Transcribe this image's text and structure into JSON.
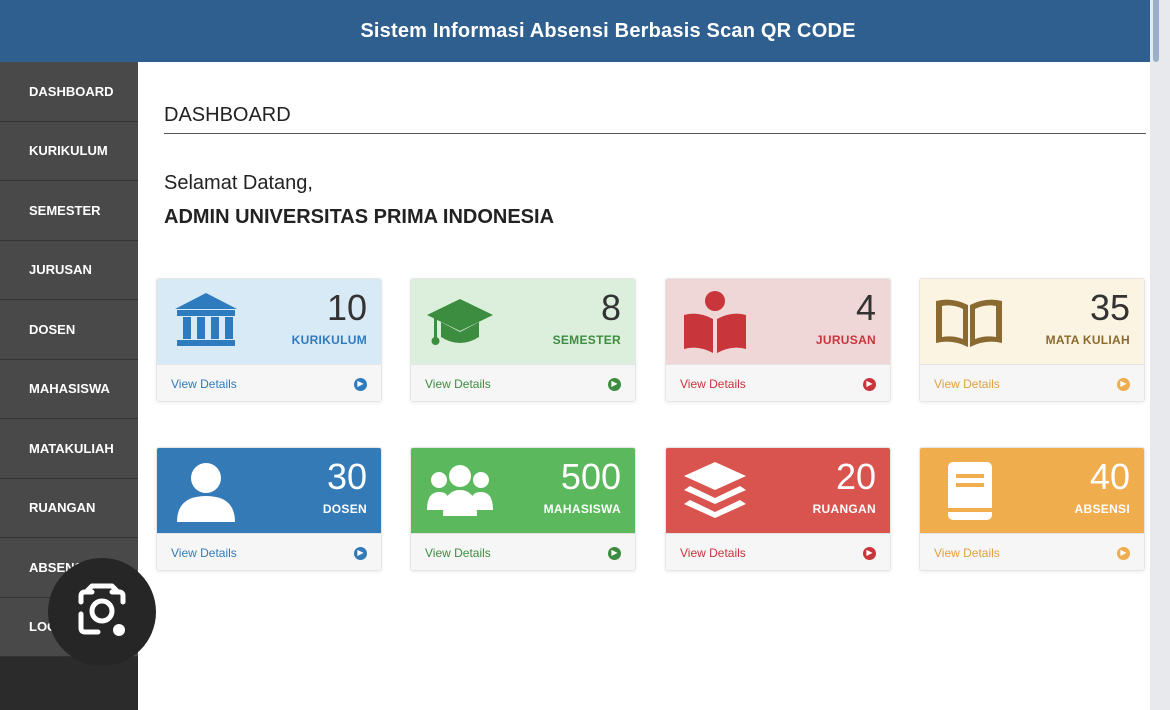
{
  "header": {
    "title": "Sistem Informasi Absensi Berbasis Scan QR CODE"
  },
  "sidebar": {
    "items": [
      {
        "label": "DASHBOARD"
      },
      {
        "label": "KURIKULUM"
      },
      {
        "label": "SEMESTER"
      },
      {
        "label": "JURUSAN"
      },
      {
        "label": "DOSEN"
      },
      {
        "label": "MAHASISWA"
      },
      {
        "label": "MATAKULIAH"
      },
      {
        "label": "RUANGAN"
      },
      {
        "label": "ABSENSI"
      },
      {
        "label": "LOGOUT"
      }
    ]
  },
  "main": {
    "page_title": "DASHBOARD",
    "welcome": "Selamat Datang,",
    "user_name": "ADMIN UNIVERSITAS PRIMA INDONESIA"
  },
  "cards": [
    {
      "count": "10",
      "label": "KURIKULUM",
      "link": "View Details",
      "icon": "building-icon",
      "color": "#2f7bbf",
      "bg": "#d9eaf7"
    },
    {
      "count": "8",
      "label": "SEMESTER",
      "link": "View Details",
      "icon": "graduation-cap-icon",
      "color": "#3c8d3f",
      "bg": "#dcefdc"
    },
    {
      "count": "4",
      "label": "JURUSAN",
      "link": "View Details",
      "icon": "reader-icon",
      "color": "#c8353a",
      "bg": "#f0d7d7"
    },
    {
      "count": "35",
      "label": "MATA KULIAH",
      "link": "View Details",
      "icon": "book-open-icon",
      "color": "#8a6a30",
      "bg": "#fcf4e2"
    },
    {
      "count": "30",
      "label": "DOSEN",
      "link": "View Details",
      "icon": "user-icon",
      "color": "#337ab7",
      "bg": "#337ab7"
    },
    {
      "count": "500",
      "label": "MAHASISWA",
      "link": "View Details",
      "icon": "users-icon",
      "color": "#5cb85c",
      "bg": "#5cb85c"
    },
    {
      "count": "20",
      "label": "RUANGAN",
      "link": "View Details",
      "icon": "layers-icon",
      "color": "#d9534f",
      "bg": "#d9534f"
    },
    {
      "count": "40",
      "label": "ABSENSI",
      "link": "View Details",
      "icon": "book-icon",
      "color": "#f0ad4e",
      "bg": "#f0ad4e"
    }
  ]
}
